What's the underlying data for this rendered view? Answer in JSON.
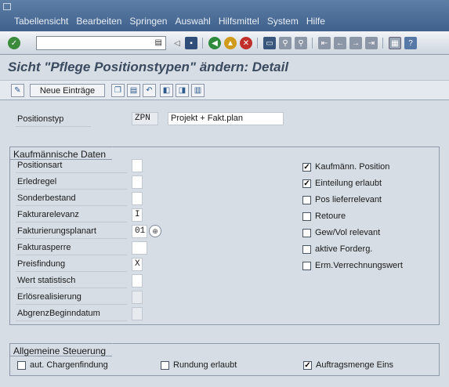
{
  "menu": [
    "Tabellensicht",
    "Bearbeiten",
    "Springen",
    "Auswahl",
    "Hilfsmittel",
    "System",
    "Hilfe"
  ],
  "toolbar": {
    "command_value": "",
    "icons": [
      "enter-icon",
      "save-icon",
      "back-icon",
      "exit-icon",
      "cancel-icon",
      "print-icon",
      "find-icon",
      "find-next-icon",
      "first-page-icon",
      "prev-page-icon",
      "next-page-icon",
      "last-page-icon",
      "create-session-icon",
      "help-icon"
    ]
  },
  "page": {
    "title": "Sicht \"Pflege Positionstypen\" ändern: Detail"
  },
  "app_toolbar": {
    "new_entries": "Neue Einträge"
  },
  "header": {
    "label": "Positionstyp",
    "code": "ZPN",
    "description": "Projekt + Fakt.plan"
  },
  "kaufm": {
    "title": "Kaufmännische Daten",
    "fields": [
      {
        "label": "Positionsart",
        "value": ""
      },
      {
        "label": "Erledregel",
        "value": ""
      },
      {
        "label": "Sonderbestand",
        "value": ""
      },
      {
        "label": "Fakturarelevanz",
        "value": "I"
      },
      {
        "label": "Fakturierungsplanart",
        "value": "01"
      },
      {
        "label": "Fakturasperre",
        "value": ""
      },
      {
        "label": "Preisfindung",
        "value": "X"
      },
      {
        "label": "Wert statistisch",
        "value": ""
      },
      {
        "label": "Erlösrealisierung",
        "value": ""
      },
      {
        "label": "AbgrenzBeginndatum",
        "value": ""
      }
    ],
    "checkboxes": [
      {
        "label": "Kaufmänn. Position",
        "checked": true
      },
      {
        "label": "Einteilung erlaubt",
        "checked": true
      },
      {
        "label": "Pos lieferrelevant",
        "checked": false
      },
      {
        "label": "Retoure",
        "checked": false
      },
      {
        "label": "Gew/Vol relevant",
        "checked": false
      },
      {
        "label": "aktive Forderg.",
        "checked": false
      },
      {
        "label": "Erm.Verrechnungswert",
        "checked": false
      }
    ]
  },
  "allgemein": {
    "title": "Allgemeine Steuerung",
    "checkboxes": [
      {
        "label": "aut. Chargenfindung",
        "checked": false
      },
      {
        "label": "Rundung erlaubt",
        "checked": false
      },
      {
        "label": "Auftragsmenge Eins",
        "checked": true
      }
    ]
  },
  "colors": {
    "menubar": "#4a6d96",
    "background": "#d6dde5",
    "title": "#3a4a5f"
  }
}
